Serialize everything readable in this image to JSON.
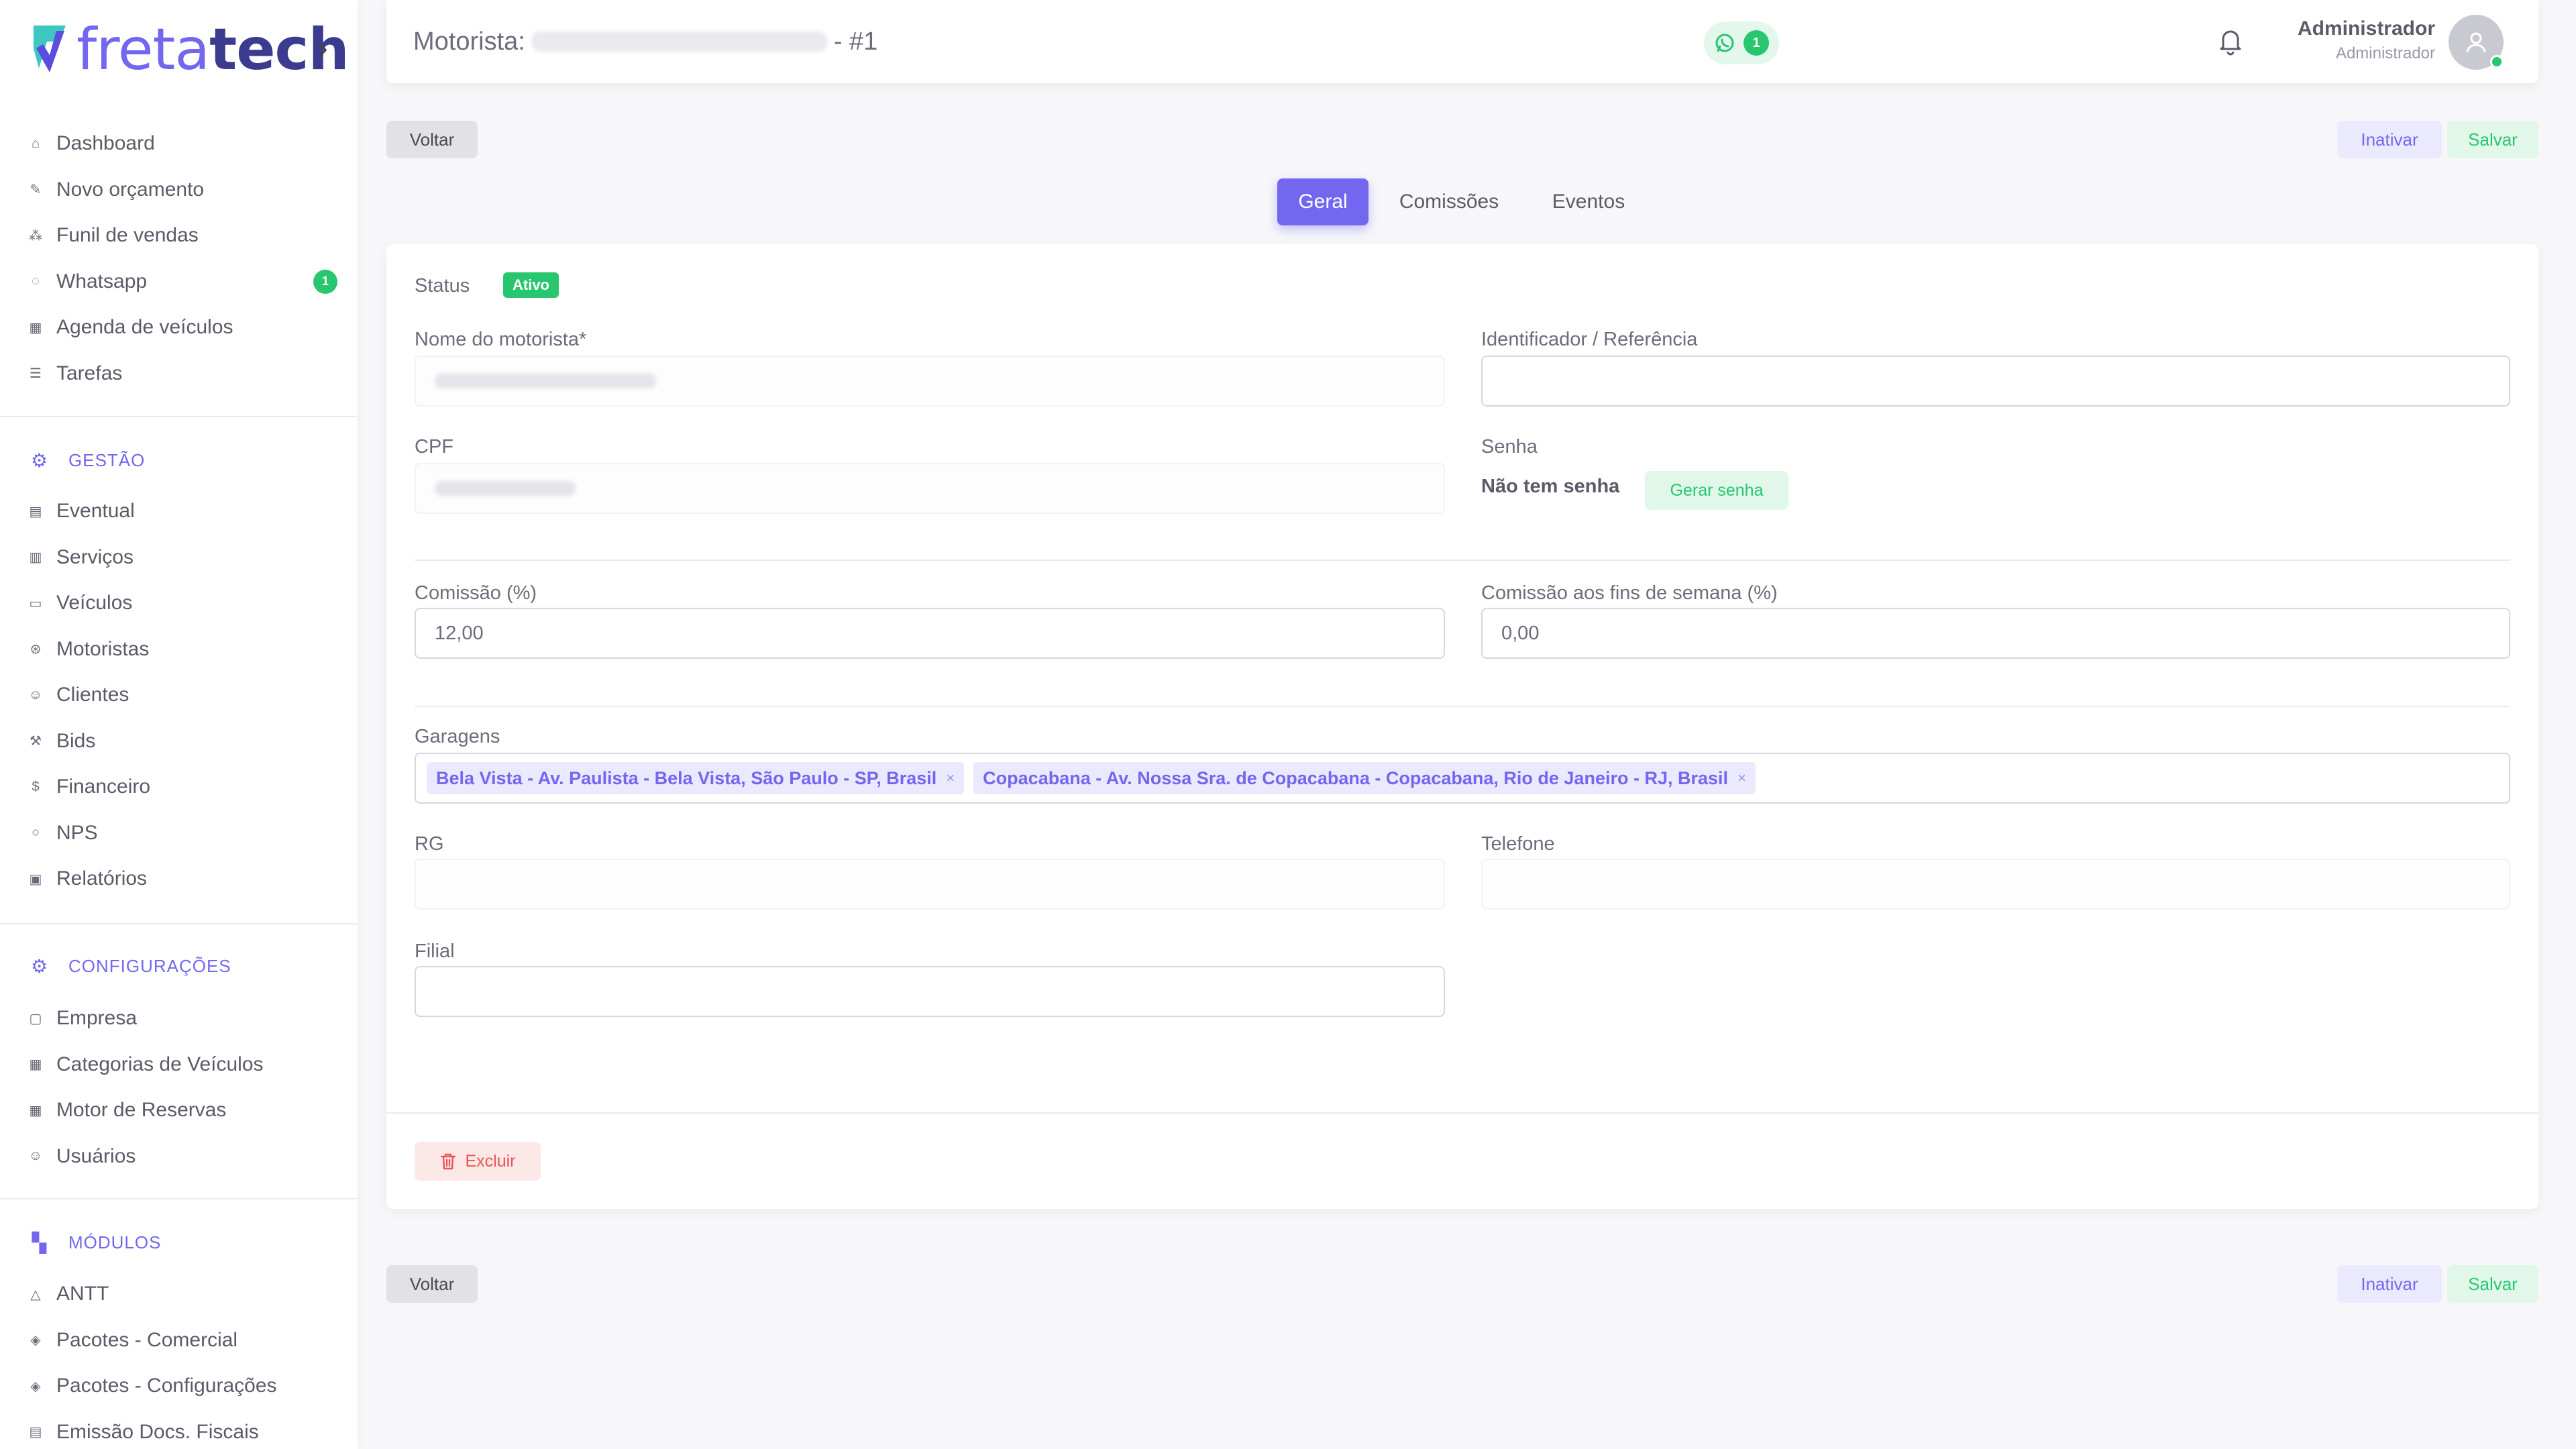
{
  "brand": {
    "part1": "freta",
    "part2": "tech"
  },
  "sidebar": {
    "main": [
      {
        "label": "Dashboard",
        "icon": "home-icon"
      },
      {
        "label": "Novo orçamento",
        "icon": "edit-icon"
      },
      {
        "label": "Funil de vendas",
        "icon": "funnel-icon"
      },
      {
        "label": "Whatsapp",
        "icon": "whatsapp-icon",
        "badge": "1"
      },
      {
        "label": "Agenda de veículos",
        "icon": "calendar-icon"
      },
      {
        "label": "Tarefas",
        "icon": "list-icon"
      }
    ],
    "gestao": {
      "header": "GESTÃO",
      "items": [
        {
          "label": "Eventual",
          "icon": "file-icon"
        },
        {
          "label": "Serviços",
          "icon": "clipboard-icon"
        },
        {
          "label": "Veículos",
          "icon": "bus-icon"
        },
        {
          "label": "Motoristas",
          "icon": "steering-wheel-icon"
        },
        {
          "label": "Clientes",
          "icon": "users-icon"
        },
        {
          "label": "Bids",
          "icon": "gavel-icon"
        },
        {
          "label": "Financeiro",
          "icon": "dollar-icon"
        },
        {
          "label": "NPS",
          "icon": "chat-icon"
        },
        {
          "label": "Relatórios",
          "icon": "report-icon"
        }
      ]
    },
    "configuracoes": {
      "header": "CONFIGURAÇÕES",
      "items": [
        {
          "label": "Empresa",
          "icon": "building-icon"
        },
        {
          "label": "Categorias de Veículos",
          "icon": "grid-icon"
        },
        {
          "label": "Motor de Reservas",
          "icon": "table-icon"
        },
        {
          "label": "Usuários",
          "icon": "user-icon"
        }
      ]
    },
    "modulos": {
      "header": "MÓDULOS",
      "items": [
        {
          "label": "ANTT",
          "icon": "triangle-icon"
        },
        {
          "label": "Pacotes - Comercial",
          "icon": "package-icon"
        },
        {
          "label": "Pacotes - Configurações",
          "icon": "package-settings-icon"
        },
        {
          "label": "Emissão Docs. Fiscais",
          "icon": "document-icon"
        }
      ]
    }
  },
  "header": {
    "title_prefix": "Motorista:",
    "title_suffix": "- #1",
    "whatsapp_count": "1",
    "user_name": "Administrador",
    "user_role": "Administrador"
  },
  "actions": {
    "back": "Voltar",
    "deactivate": "Inativar",
    "save": "Salvar"
  },
  "tabs": [
    {
      "label": "Geral",
      "active": true
    },
    {
      "label": "Comissões",
      "active": false
    },
    {
      "label": "Eventos",
      "active": false
    }
  ],
  "form": {
    "status_label": "Status",
    "status_value": "Ativo",
    "nome_label": "Nome do motorista*",
    "identificador_label": "Identificador / Referência",
    "identificador_value": "",
    "cpf_label": "CPF",
    "senha_label": "Senha",
    "senha_value": "Não tem senha",
    "gerar_senha": "Gerar senha",
    "comissao_label": "Comissão (%)",
    "comissao_value": "12,00",
    "comissao_fds_label": "Comissão aos fins de semana (%)",
    "comissao_fds_value": "0,00",
    "garagens_label": "Garagens",
    "garagens": [
      "Bela Vista - Av. Paulista - Bela Vista, São Paulo - SP, Brasil",
      "Copacabana - Av. Nossa Sra. de Copacabana - Copacabana, Rio de Janeiro - RJ, Brasil"
    ],
    "chip_remove": "×",
    "rg_label": "RG",
    "telefone_label": "Telefone",
    "filial_label": "Filial",
    "filial_value": "",
    "excluir": "Excluir"
  },
  "colors": {
    "primary": "#7367f0",
    "success": "#28c76f",
    "danger": "#ea5455",
    "background": "#f7f7f9"
  }
}
